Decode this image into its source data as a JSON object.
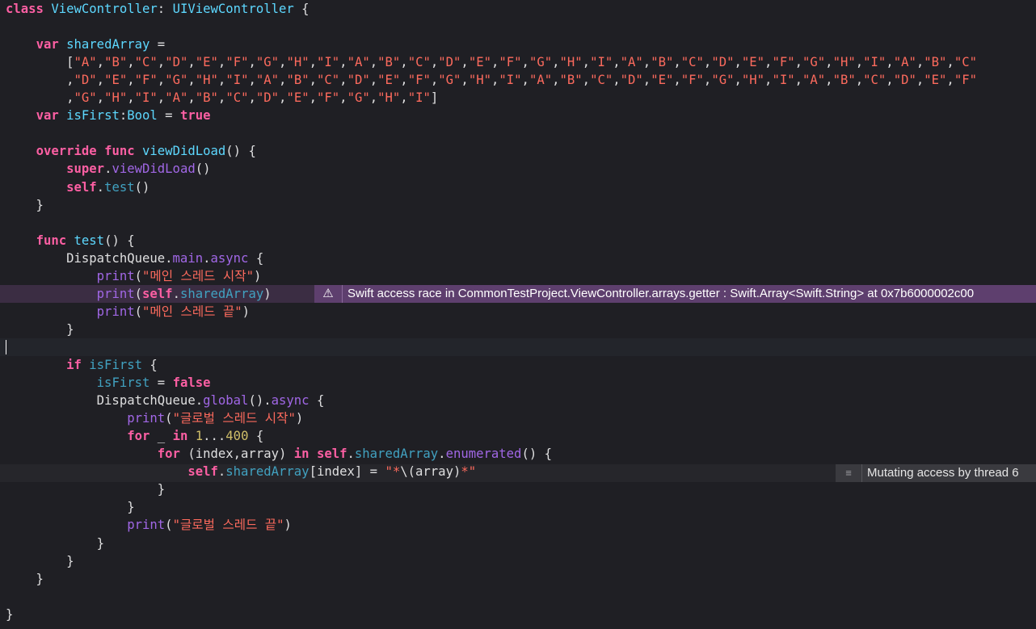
{
  "colors": {
    "background": "#1f1f24",
    "keyword": "#fc5fa3",
    "type": "#5dd8ff",
    "property": "#41a1c0",
    "function": "#a167e6",
    "string": "#fc6a5d",
    "number": "#d0bf69",
    "plain": "#dfdfe0",
    "issue_badge": "#5e3f6e",
    "issue_line": "#3b2d43",
    "note_badge": "#3a3a3f"
  },
  "issue": {
    "icon": "warning-triangle-icon",
    "message": "Swift access race in CommonTestProject.ViewController.arrays.getter : Swift.Array<Swift.String> at 0x7b6000002c00"
  },
  "note": {
    "icon": "note-lines-icon",
    "message": "Mutating access by thread 6"
  },
  "lines": [
    [
      [
        "kw",
        "class"
      ],
      [
        "pl",
        " "
      ],
      [
        "ty",
        "ViewController"
      ],
      [
        "pl",
        ": "
      ],
      [
        "ty",
        "UIViewController"
      ],
      [
        "pl",
        " {"
      ]
    ],
    [],
    [
      [
        "pl",
        "    "
      ],
      [
        "kw",
        "var"
      ],
      [
        "pl",
        " "
      ],
      [
        "ty",
        "sharedArray"
      ],
      [
        "pl",
        " ="
      ]
    ],
    [
      [
        "pl",
        "        ["
      ],
      [
        "str",
        "\"A\""
      ],
      [
        "pl",
        ","
      ],
      [
        "str",
        "\"B\""
      ],
      [
        "pl",
        ","
      ],
      [
        "str",
        "\"C\""
      ],
      [
        "pl",
        ","
      ],
      [
        "str",
        "\"D\""
      ],
      [
        "pl",
        ","
      ],
      [
        "str",
        "\"E\""
      ],
      [
        "pl",
        ","
      ],
      [
        "str",
        "\"F\""
      ],
      [
        "pl",
        ","
      ],
      [
        "str",
        "\"G\""
      ],
      [
        "pl",
        ","
      ],
      [
        "str",
        "\"H\""
      ],
      [
        "pl",
        ","
      ],
      [
        "str",
        "\"I\""
      ],
      [
        "pl",
        ","
      ],
      [
        "str",
        "\"A\""
      ],
      [
        "pl",
        ","
      ],
      [
        "str",
        "\"B\""
      ],
      [
        "pl",
        ","
      ],
      [
        "str",
        "\"C\""
      ],
      [
        "pl",
        ","
      ],
      [
        "str",
        "\"D\""
      ],
      [
        "pl",
        ","
      ],
      [
        "str",
        "\"E\""
      ],
      [
        "pl",
        ","
      ],
      [
        "str",
        "\"F\""
      ],
      [
        "pl",
        ","
      ],
      [
        "str",
        "\"G\""
      ],
      [
        "pl",
        ","
      ],
      [
        "str",
        "\"H\""
      ],
      [
        "pl",
        ","
      ],
      [
        "str",
        "\"I\""
      ],
      [
        "pl",
        ","
      ],
      [
        "str",
        "\"A\""
      ],
      [
        "pl",
        ","
      ],
      [
        "str",
        "\"B\""
      ],
      [
        "pl",
        ","
      ],
      [
        "str",
        "\"C\""
      ],
      [
        "pl",
        ","
      ],
      [
        "str",
        "\"D\""
      ],
      [
        "pl",
        ","
      ],
      [
        "str",
        "\"E\""
      ],
      [
        "pl",
        ","
      ],
      [
        "str",
        "\"F\""
      ],
      [
        "pl",
        ","
      ],
      [
        "str",
        "\"G\""
      ],
      [
        "pl",
        ","
      ],
      [
        "str",
        "\"H\""
      ],
      [
        "pl",
        ","
      ],
      [
        "str",
        "\"I\""
      ],
      [
        "pl",
        ","
      ],
      [
        "str",
        "\"A\""
      ],
      [
        "pl",
        ","
      ],
      [
        "str",
        "\"B\""
      ],
      [
        "pl",
        ","
      ],
      [
        "str",
        "\"C\""
      ]
    ],
    [
      [
        "pl",
        "        ,"
      ],
      [
        "str",
        "\"D\""
      ],
      [
        "pl",
        ","
      ],
      [
        "str",
        "\"E\""
      ],
      [
        "pl",
        ","
      ],
      [
        "str",
        "\"F\""
      ],
      [
        "pl",
        ","
      ],
      [
        "str",
        "\"G\""
      ],
      [
        "pl",
        ","
      ],
      [
        "str",
        "\"H\""
      ],
      [
        "pl",
        ","
      ],
      [
        "str",
        "\"I\""
      ],
      [
        "pl",
        ","
      ],
      [
        "str",
        "\"A\""
      ],
      [
        "pl",
        ","
      ],
      [
        "str",
        "\"B\""
      ],
      [
        "pl",
        ","
      ],
      [
        "str",
        "\"C\""
      ],
      [
        "pl",
        ","
      ],
      [
        "str",
        "\"D\""
      ],
      [
        "pl",
        ","
      ],
      [
        "str",
        "\"E\""
      ],
      [
        "pl",
        ","
      ],
      [
        "str",
        "\"F\""
      ],
      [
        "pl",
        ","
      ],
      [
        "str",
        "\"G\""
      ],
      [
        "pl",
        ","
      ],
      [
        "str",
        "\"H\""
      ],
      [
        "pl",
        ","
      ],
      [
        "str",
        "\"I\""
      ],
      [
        "pl",
        ","
      ],
      [
        "str",
        "\"A\""
      ],
      [
        "pl",
        ","
      ],
      [
        "str",
        "\"B\""
      ],
      [
        "pl",
        ","
      ],
      [
        "str",
        "\"C\""
      ],
      [
        "pl",
        ","
      ],
      [
        "str",
        "\"D\""
      ],
      [
        "pl",
        ","
      ],
      [
        "str",
        "\"E\""
      ],
      [
        "pl",
        ","
      ],
      [
        "str",
        "\"F\""
      ],
      [
        "pl",
        ","
      ],
      [
        "str",
        "\"G\""
      ],
      [
        "pl",
        ","
      ],
      [
        "str",
        "\"H\""
      ],
      [
        "pl",
        ","
      ],
      [
        "str",
        "\"I\""
      ],
      [
        "pl",
        ","
      ],
      [
        "str",
        "\"A\""
      ],
      [
        "pl",
        ","
      ],
      [
        "str",
        "\"B\""
      ],
      [
        "pl",
        ","
      ],
      [
        "str",
        "\"C\""
      ],
      [
        "pl",
        ","
      ],
      [
        "str",
        "\"D\""
      ],
      [
        "pl",
        ","
      ],
      [
        "str",
        "\"E\""
      ],
      [
        "pl",
        ","
      ],
      [
        "str",
        "\"F\""
      ]
    ],
    [
      [
        "pl",
        "        ,"
      ],
      [
        "str",
        "\"G\""
      ],
      [
        "pl",
        ","
      ],
      [
        "str",
        "\"H\""
      ],
      [
        "pl",
        ","
      ],
      [
        "str",
        "\"I\""
      ],
      [
        "pl",
        ","
      ],
      [
        "str",
        "\"A\""
      ],
      [
        "pl",
        ","
      ],
      [
        "str",
        "\"B\""
      ],
      [
        "pl",
        ","
      ],
      [
        "str",
        "\"C\""
      ],
      [
        "pl",
        ","
      ],
      [
        "str",
        "\"D\""
      ],
      [
        "pl",
        ","
      ],
      [
        "str",
        "\"E\""
      ],
      [
        "pl",
        ","
      ],
      [
        "str",
        "\"F\""
      ],
      [
        "pl",
        ","
      ],
      [
        "str",
        "\"G\""
      ],
      [
        "pl",
        ","
      ],
      [
        "str",
        "\"H\""
      ],
      [
        "pl",
        ","
      ],
      [
        "str",
        "\"I\""
      ],
      [
        "pl",
        "]"
      ]
    ],
    [
      [
        "pl",
        "    "
      ],
      [
        "kw",
        "var"
      ],
      [
        "pl",
        " "
      ],
      [
        "ty",
        "isFirst"
      ],
      [
        "pl",
        ":"
      ],
      [
        "ty",
        "Bool"
      ],
      [
        "pl",
        " = "
      ],
      [
        "kw",
        "true"
      ]
    ],
    [],
    [
      [
        "pl",
        "    "
      ],
      [
        "kw",
        "override"
      ],
      [
        "pl",
        " "
      ],
      [
        "kw",
        "func"
      ],
      [
        "pl",
        " "
      ],
      [
        "ty",
        "viewDidLoad"
      ],
      [
        "pl",
        "() {"
      ]
    ],
    [
      [
        "pl",
        "        "
      ],
      [
        "kw",
        "super"
      ],
      [
        "pl",
        "."
      ],
      [
        "fn",
        "viewDidLoad"
      ],
      [
        "pl",
        "()"
      ]
    ],
    [
      [
        "pl",
        "        "
      ],
      [
        "kw",
        "self"
      ],
      [
        "pl",
        "."
      ],
      [
        "prop",
        "test"
      ],
      [
        "pl",
        "()"
      ]
    ],
    [
      [
        "pl",
        "    }"
      ]
    ],
    [],
    [
      [
        "pl",
        "    "
      ],
      [
        "kw",
        "func"
      ],
      [
        "pl",
        " "
      ],
      [
        "ty",
        "test"
      ],
      [
        "pl",
        "() {"
      ]
    ],
    [
      [
        "pl",
        "        DispatchQueue."
      ],
      [
        "fn",
        "main"
      ],
      [
        "pl",
        "."
      ],
      [
        "fn",
        "async"
      ],
      [
        "pl",
        " {"
      ]
    ],
    [
      [
        "pl",
        "            "
      ],
      [
        "fn",
        "print"
      ],
      [
        "pl",
        "("
      ],
      [
        "str",
        "\"메인 스레드 시작\""
      ],
      [
        "pl",
        ")"
      ]
    ],
    [
      [
        "pl",
        "            "
      ],
      [
        "fn",
        "print"
      ],
      [
        "pl",
        "("
      ],
      [
        "kw",
        "self"
      ],
      [
        "pl",
        "."
      ],
      [
        "prop",
        "sharedArray"
      ],
      [
        "pl",
        ")"
      ]
    ],
    [
      [
        "pl",
        "            "
      ],
      [
        "fn",
        "print"
      ],
      [
        "pl",
        "("
      ],
      [
        "str",
        "\"메인 스레드 끝\""
      ],
      [
        "pl",
        ")"
      ]
    ],
    [
      [
        "pl",
        "        }"
      ]
    ],
    [],
    [
      [
        "pl",
        "        "
      ],
      [
        "kw",
        "if"
      ],
      [
        "pl",
        " "
      ],
      [
        "prop",
        "isFirst"
      ],
      [
        "pl",
        " {"
      ]
    ],
    [
      [
        "pl",
        "            "
      ],
      [
        "prop",
        "isFirst"
      ],
      [
        "pl",
        " = "
      ],
      [
        "kw",
        "false"
      ]
    ],
    [
      [
        "pl",
        "            DispatchQueue."
      ],
      [
        "fn",
        "global"
      ],
      [
        "pl",
        "()."
      ],
      [
        "fn",
        "async"
      ],
      [
        "pl",
        " {"
      ]
    ],
    [
      [
        "pl",
        "                "
      ],
      [
        "fn",
        "print"
      ],
      [
        "pl",
        "("
      ],
      [
        "str",
        "\"글로벌 스레드 시작\""
      ],
      [
        "pl",
        ")"
      ]
    ],
    [
      [
        "pl",
        "                "
      ],
      [
        "kw",
        "for"
      ],
      [
        "pl",
        " _ "
      ],
      [
        "kw",
        "in"
      ],
      [
        "pl",
        " "
      ],
      [
        "num",
        "1"
      ],
      [
        "pl",
        "..."
      ],
      [
        "num",
        "400"
      ],
      [
        "pl",
        " {"
      ]
    ],
    [
      [
        "pl",
        "                    "
      ],
      [
        "kw",
        "for"
      ],
      [
        "pl",
        " (index,array) "
      ],
      [
        "kw",
        "in"
      ],
      [
        "pl",
        " "
      ],
      [
        "kw",
        "self"
      ],
      [
        "pl",
        "."
      ],
      [
        "prop",
        "sharedArray"
      ],
      [
        "pl",
        "."
      ],
      [
        "fn",
        "enumerated"
      ],
      [
        "pl",
        "() {"
      ]
    ],
    [
      [
        "pl",
        "                        "
      ],
      [
        "kw",
        "self"
      ],
      [
        "pl",
        "."
      ],
      [
        "prop",
        "sharedArray"
      ],
      [
        "pl",
        "[index] = "
      ],
      [
        "str",
        "\"*"
      ],
      [
        "pl",
        "\\(array)"
      ],
      [
        "str",
        "*\""
      ]
    ],
    [
      [
        "pl",
        "                    }"
      ]
    ],
    [
      [
        "pl",
        "                }"
      ]
    ],
    [
      [
        "pl",
        "                "
      ],
      [
        "fn",
        "print"
      ],
      [
        "pl",
        "("
      ],
      [
        "str",
        "\"글로벌 스레드 끝\""
      ],
      [
        "pl",
        ")"
      ]
    ],
    [
      [
        "pl",
        "            }"
      ]
    ],
    [
      [
        "pl",
        "        }"
      ]
    ],
    [
      [
        "pl",
        "    }"
      ]
    ],
    [],
    [
      [
        "pl",
        "}"
      ]
    ]
  ]
}
